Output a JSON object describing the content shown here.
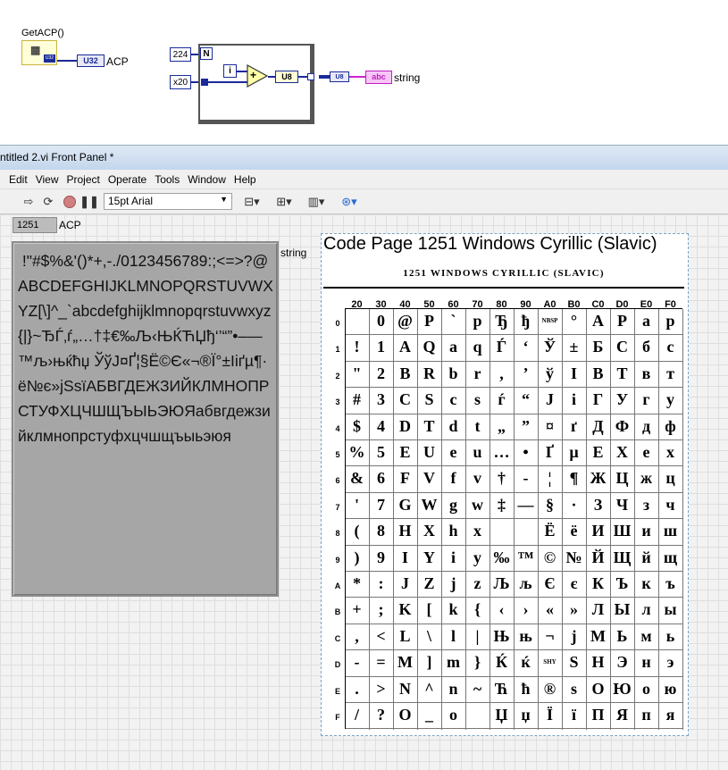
{
  "block_diagram": {
    "function_label": "GetACP()",
    "output_type": "U32",
    "output_label": "ACP",
    "const_224": "224",
    "const_x20": "x20",
    "loop_count": "N",
    "loop_index": "i",
    "add_op": "+",
    "convert_type": "U8",
    "array_type": "U8",
    "string_type": "abc",
    "string_label": "string"
  },
  "window": {
    "title": "ntitled 2.vi Front Panel *"
  },
  "menu": [
    "Edit",
    "View",
    "Project",
    "Operate",
    "Tools",
    "Window",
    "Help"
  ],
  "toolbar": {
    "font": "15pt Arial"
  },
  "front_panel": {
    "acp_value": "1251",
    "acp_label": "ACP",
    "string_label": "string",
    "string_value": " !\"#$%&'()*+,-./0123456789:;<=>?@ABCDEFGHIJKLMNOPQRSTUVWXYZ[\\]^_`abcdefghijklmnopqrstuvwxyz{|}~ЂЃ‚ѓ„…†‡€‰Љ‹ЊЌЋЏђ‘’“”•–—™љ›њќћџ ЎўЈ¤Ґ¦§Ё©Є«¬­®Ї°±Ііґµ¶·ё№є»јЅѕїАБВГДЕЖЗИЙКЛМНОПРСТУФХЦЧШЩЪЫЬЭЮЯабвгдежзийклмнопрстуфхцчшщъыьэюя"
  },
  "codepage_image": {
    "title": "Code Page 1251 Windows Cyrillic (Slavic)",
    "subtitle": "1251 WINDOWS CYRILLIC (SLAVIC)",
    "columns": [
      "20",
      "30",
      "40",
      "50",
      "60",
      "70",
      "80",
      "90",
      "A0",
      "B0",
      "C0",
      "D0",
      "E0",
      "F0"
    ],
    "rows": [
      "0",
      "1",
      "2",
      "3",
      "4",
      "5",
      "6",
      "7",
      "8",
      "9",
      "A",
      "B",
      "C",
      "D",
      "E",
      "F"
    ],
    "cells": [
      [
        "",
        "0",
        "@",
        "P",
        "`",
        "p",
        "Ђ",
        "ђ",
        "NBSP",
        "°",
        "А",
        "Р",
        "а",
        "р"
      ],
      [
        "!",
        "1",
        "A",
        "Q",
        "a",
        "q",
        "Ѓ",
        "‘",
        "Ў",
        "±",
        "Б",
        "С",
        "б",
        "с"
      ],
      [
        "\"",
        "2",
        "B",
        "R",
        "b",
        "r",
        ",",
        "’",
        "ў",
        "I",
        "В",
        "Т",
        "в",
        "т"
      ],
      [
        "#",
        "3",
        "C",
        "S",
        "c",
        "s",
        "ѓ",
        "“",
        "J",
        "i",
        "Г",
        "У",
        "г",
        "у"
      ],
      [
        "$",
        "4",
        "D",
        "T",
        "d",
        "t",
        "„",
        "”",
        "¤",
        "ґ",
        "Д",
        "Ф",
        "д",
        "ф"
      ],
      [
        "%",
        "5",
        "E",
        "U",
        "e",
        "u",
        "…",
        "•",
        "Ґ",
        "µ",
        "Е",
        "Х",
        "е",
        "х"
      ],
      [
        "&",
        "6",
        "F",
        "V",
        "f",
        "v",
        "†",
        "-",
        "¦",
        "¶",
        "Ж",
        "Ц",
        "ж",
        "ц"
      ],
      [
        "'",
        "7",
        "G",
        "W",
        "g",
        "w",
        "‡",
        "—",
        "§",
        "·",
        "З",
        "Ч",
        "з",
        "ч"
      ],
      [
        "(",
        "8",
        "H",
        "X",
        "h",
        "x",
        "",
        "",
        "Ё",
        "ё",
        "И",
        "Ш",
        "и",
        "ш"
      ],
      [
        ")",
        "9",
        "I",
        "Y",
        "i",
        "y",
        "‰",
        "™",
        "©",
        "№",
        "Й",
        "Щ",
        "й",
        "щ"
      ],
      [
        "*",
        ":",
        "J",
        "Z",
        "j",
        "z",
        "Љ",
        "љ",
        "Є",
        "є",
        "К",
        "Ъ",
        "к",
        "ъ"
      ],
      [
        "+",
        ";",
        "K",
        "[",
        "k",
        "{",
        "‹",
        "›",
        "«",
        "»",
        "Л",
        "Ы",
        "л",
        "ы"
      ],
      [
        ",",
        "<",
        "L",
        "\\",
        "l",
        "|",
        "Њ",
        "њ",
        "¬",
        "ј",
        "М",
        "Ь",
        "м",
        "ь"
      ],
      [
        "-",
        "=",
        "M",
        "]",
        "m",
        "}",
        "Ќ",
        "ќ",
        "SHY",
        "Ѕ",
        "Н",
        "Э",
        "н",
        "э"
      ],
      [
        ".",
        ">",
        "N",
        "^",
        "n",
        "~",
        "Ћ",
        "ћ",
        "®",
        "ѕ",
        "О",
        "Ю",
        "о",
        "ю"
      ],
      [
        "/",
        "?",
        "O",
        "_",
        "o",
        "",
        "Џ",
        "џ",
        "Ї",
        "ї",
        "П",
        "Я",
        "п",
        "я"
      ]
    ]
  }
}
